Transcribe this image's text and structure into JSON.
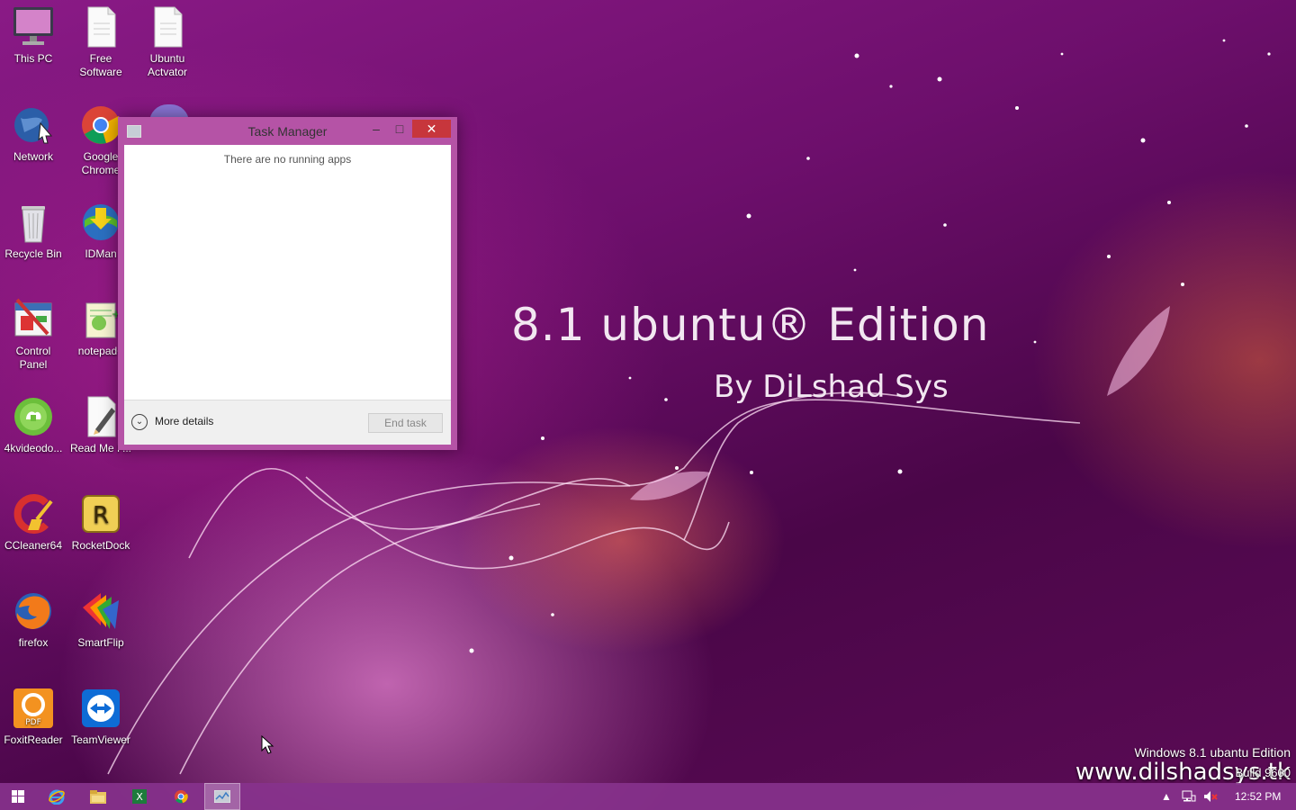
{
  "wallpaper": {
    "title": "8.1 ubuntu® Edition",
    "subtitle": "By DiLshad Sys"
  },
  "desktop_icons": [
    {
      "label": "This PC",
      "icon": "computer-icon"
    },
    {
      "label": "Free Software",
      "icon": "document-icon"
    },
    {
      "label": "Ubuntu Actvator",
      "icon": "document-icon"
    },
    {
      "label": "Network",
      "icon": "network-globe-icon"
    },
    {
      "label": "Google Chrome",
      "icon": "chrome-icon"
    },
    {
      "label": "Recycle Bin",
      "icon": "recycle-bin-icon"
    },
    {
      "label": "IDMan",
      "icon": "idm-icon"
    },
    {
      "label": "Control Panel",
      "icon": "control-panel-icon"
    },
    {
      "label": "notepad+",
      "icon": "notepad-plus-icon"
    },
    {
      "label": "4kvideodo...",
      "icon": "4kvideo-downloader-icon"
    },
    {
      "label": "Read Me F...",
      "icon": "read-me-file-icon"
    },
    {
      "label": "CCleaner64",
      "icon": "ccleaner-icon"
    },
    {
      "label": "RocketDock",
      "icon": "rocketdock-icon"
    },
    {
      "label": "firefox",
      "icon": "firefox-icon"
    },
    {
      "label": "SmartFlip",
      "icon": "smartflip-icon"
    },
    {
      "label": "FoxitReader",
      "icon": "foxit-reader-icon"
    },
    {
      "label": "TeamViewer",
      "icon": "teamviewer-icon"
    }
  ],
  "task_manager": {
    "title": "Task Manager",
    "minimize": "–",
    "maximize": "□",
    "close": "✕",
    "message": "There are no running apps",
    "more_details": "More details",
    "end_task": "End task"
  },
  "watermark": {
    "edition": "Windows 8.1 ubantu Edition",
    "site": "www.dilshadsys.tk",
    "build": "Build 9600"
  },
  "taskbar": {
    "items": [
      "start-icon",
      "internet-explorer-icon",
      "file-explorer-icon",
      "excel-icon",
      "chrome-icon",
      "task-manager-icon"
    ],
    "clock": "12:52 PM"
  }
}
